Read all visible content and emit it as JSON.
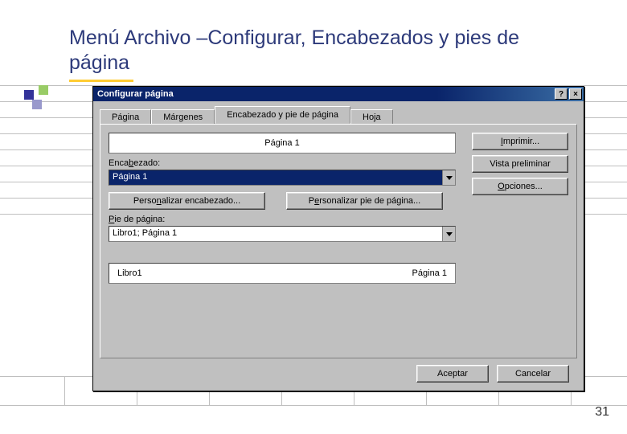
{
  "slide": {
    "title": "Menú Archivo –Configurar, Encabezados y pies de página",
    "page_number": "31"
  },
  "window": {
    "title": "Configurar página",
    "help_glyph": "?",
    "close_glyph": "×"
  },
  "tabs": {
    "pagina": "Página",
    "margenes": "Márgenes",
    "encabezado": "Encabezado y pie de página",
    "hoja": "Hoja"
  },
  "panel": {
    "header_preview_center": "Página 1",
    "encabezado_label_pre": "Enca",
    "encabezado_label_u": "b",
    "encabezado_label_post": "ezado:",
    "header_combo_value": "Página 1",
    "personalizar_enc_pre": "Perso",
    "personalizar_enc_u": "n",
    "personalizar_enc_post": "alizar encabezado...",
    "personalizar_pie_pre": "P",
    "personalizar_pie_u": "e",
    "personalizar_pie_post": "rsonalizar pie de página...",
    "pie_label_pre": "",
    "pie_label_u": "P",
    "pie_label_post": "ie de página:",
    "footer_combo_value": "Libro1; Página 1",
    "footer_preview_left": "Libro1",
    "footer_preview_right": "Página 1"
  },
  "side": {
    "imprimir_pre": "",
    "imprimir_u": "I",
    "imprimir_post": "mprimir...",
    "vista": "Vista preliminar",
    "opciones_pre": "",
    "opciones_u": "O",
    "opciones_post": "pciones..."
  },
  "footer_buttons": {
    "ok": "Aceptar",
    "cancel": "Cancelar"
  }
}
